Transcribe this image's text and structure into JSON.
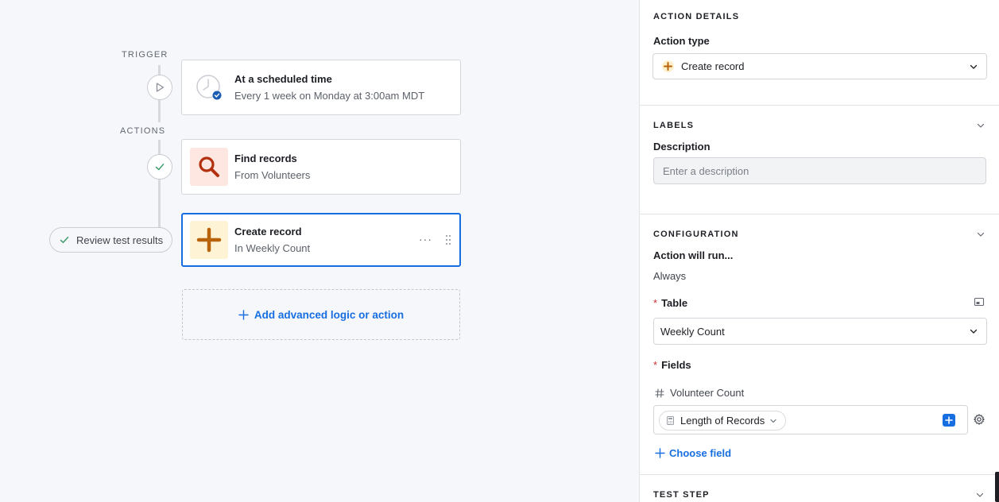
{
  "canvas": {
    "trigger_label": "TRIGGER",
    "actions_label": "ACTIONS",
    "trigger_card": {
      "title": "At a scheduled time",
      "subtitle": "Every 1 week on Monday at 3:00am MDT",
      "icon": "clock-icon"
    },
    "find_card": {
      "title": "Find records",
      "subtitle": "From Volunteers",
      "icon": "search-icon",
      "icon_bg": "#fde7e0",
      "icon_color": "#b3300f"
    },
    "create_card": {
      "title": "Create record",
      "subtitle": "In Weekly Count",
      "icon": "plus-icon",
      "icon_bg": "#fff3d6",
      "icon_color": "#b8620a",
      "more": "···"
    },
    "review_button": "Review test results",
    "add_action": "Add advanced logic or action"
  },
  "panel": {
    "action_details": {
      "heading": "ACTION DETAILS",
      "action_type_label": "Action type",
      "action_type_value": "Create record"
    },
    "labels": {
      "heading": "LABELS",
      "description_label": "Description",
      "description_placeholder": "Enter a description"
    },
    "configuration": {
      "heading": "CONFIGURATION",
      "run_label": "Action will run...",
      "run_value": "Always",
      "table_label": "Table",
      "table_value": "Weekly Count",
      "fields_label": "Fields",
      "field_name": "Volunteer Count",
      "field_token": "Length of Records",
      "choose_field": "Choose field"
    },
    "test_step": {
      "heading": "TEST STEP"
    }
  },
  "colors": {
    "accent": "#166ee1",
    "required": "#d43131"
  }
}
